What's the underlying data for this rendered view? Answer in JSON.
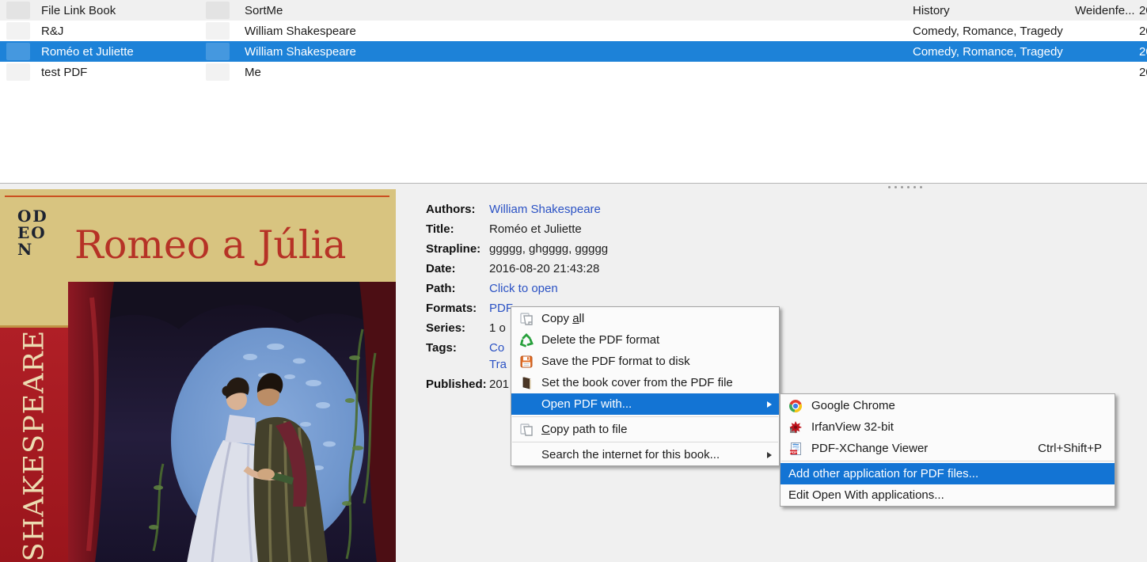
{
  "colors": {
    "selection_blue": "#1d82d8",
    "menu_highlight_blue": "#1374d4",
    "link_blue": "#2b52c4",
    "panel_gray": "#f0f0f0",
    "cover_tan": "#d8c480",
    "cover_red_spine": "#a81b22"
  },
  "table": {
    "rows": [
      {
        "title": "File Link Book",
        "authors": "SortMe",
        "tags": "History",
        "publisher": "Weidenfe...",
        "date": "20"
      },
      {
        "title": "R&J",
        "authors": "William Shakespeare",
        "tags": "Comedy, Romance, Tragedy",
        "publisher": "",
        "date": "20"
      },
      {
        "title": "Roméo et Juliette",
        "authors": "William Shakespeare",
        "tags": "Comedy, Romance, Tragedy",
        "publisher": "",
        "date": "20"
      },
      {
        "title": "test PDF",
        "authors": "Me",
        "tags": "",
        "publisher": "",
        "date": "20"
      }
    ]
  },
  "details": {
    "authors_label": "Authors:",
    "authors_value": "William Shakespeare",
    "title_label": "Title:",
    "title_value": "Roméo et Juliette",
    "strapline_label": "Strapline:",
    "strapline_value": "ggggg, ghgggg, ggggg",
    "date_label": "Date:",
    "date_value": "2016-08-20 21:43:28",
    "path_label": "Path:",
    "path_value": "Click to open",
    "formats_label": "Formats:",
    "formats_value": "PDF",
    "series_label": "Series:",
    "series_value": "1 o",
    "tags_label": "Tags:",
    "tags_value_line1": "Co",
    "tags_value_line2": "Tra",
    "published_label": "Published:",
    "published_value": "201"
  },
  "cover": {
    "logo": "ODEON",
    "title": "Romeo a Júlia",
    "author": "SHAKESPEARE"
  },
  "context_menu": {
    "copy_all_pre": "Copy ",
    "copy_all_accel": "a",
    "copy_all_post": "ll",
    "delete_format": "Delete the PDF format",
    "save_format": "Save the PDF format to disk",
    "set_cover": "Set the book cover from the PDF file",
    "open_with": "Open PDF with...",
    "copy_path_accel": "C",
    "copy_path_post": "opy path to file",
    "search_internet": "Search the internet for this book..."
  },
  "submenu": {
    "chrome": "Google Chrome",
    "irfanview": "IrfanView 32-bit",
    "pdfxchange": "PDF-XChange Viewer",
    "pdfxchange_shortcut": "Ctrl+Shift+P",
    "add_other": "Add other application for PDF files...",
    "edit_openwith": "Edit Open With applications..."
  }
}
